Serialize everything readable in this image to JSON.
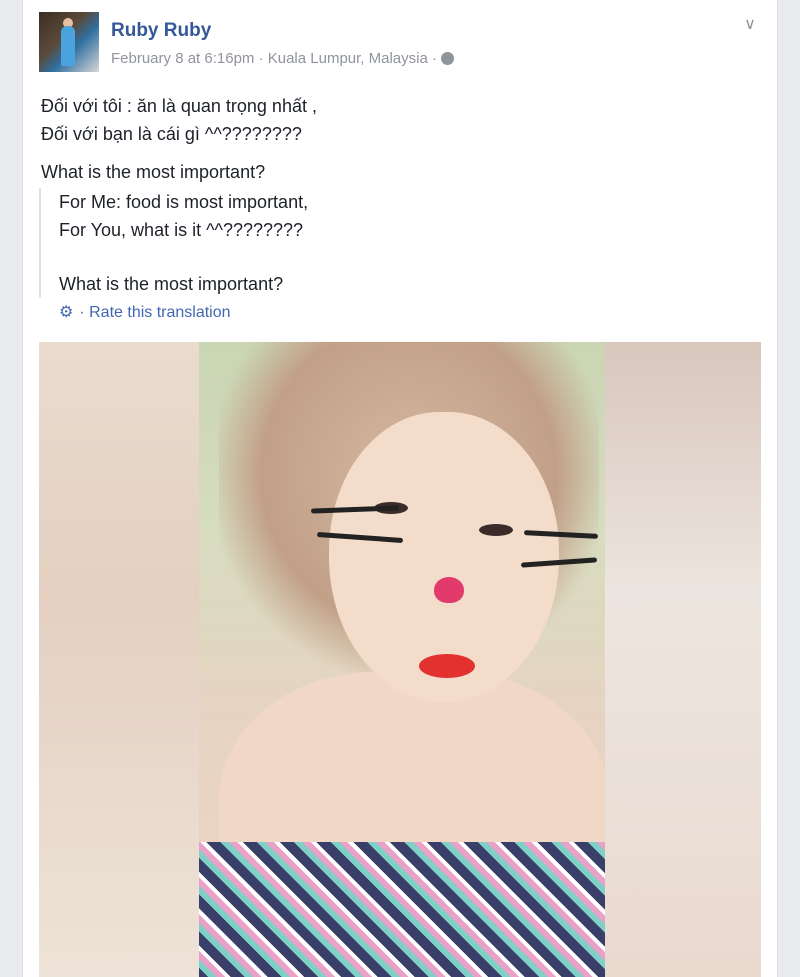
{
  "post": {
    "author": "Ruby Ruby",
    "meta": "February 8 at 6:16pm · Kuala Lumpur, Malaysia ·",
    "text_line1": "Đối với tôi : ăn là quan trọng nhất ,",
    "text_line2": "Đối với bạn là cái gì ^^????????",
    "text_line3": "What is the most important?",
    "translation_line1": "For Me: food is most important,",
    "translation_line2": "For You, what is it ^^????????",
    "translation_line3": "What is the most important?",
    "rate_translation": "Rate this translation"
  },
  "icons": {
    "privacy": "globe-icon",
    "options": "chevron-down-icon",
    "settings": "gear-icon"
  },
  "colors": {
    "name": "#365899",
    "meta": "#90949c",
    "link": "#4267b2",
    "text": "#1d2129"
  }
}
